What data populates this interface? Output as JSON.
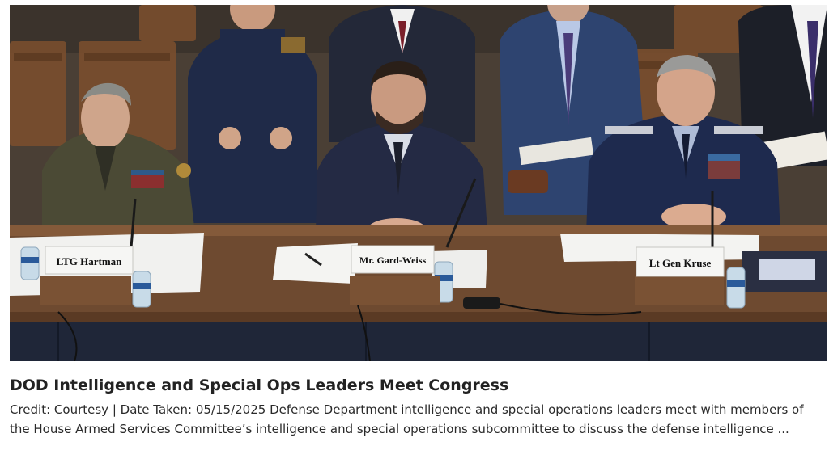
{
  "photo": {
    "alt": "Three witnesses seated at a congressional hearing table with name placards",
    "nameplates": {
      "left": "LTG Hartman",
      "center": "Mr. Gard-Weiss",
      "right": "Lt Gen Kruse"
    }
  },
  "caption": {
    "title": "DOD Intelligence and Special Ops Leaders Meet Congress",
    "body": "Credit: Courtesy | Date Taken: 05/15/2025 Defense Department intelligence and special operations leaders meet with members of the House Armed Services Committee’s intelligence and special operations subcommittee to discuss the defense intelligence ..."
  }
}
